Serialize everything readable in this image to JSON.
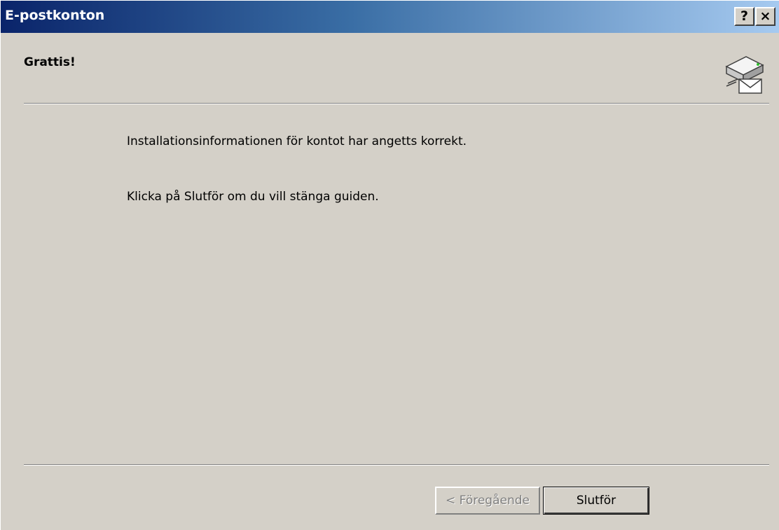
{
  "window": {
    "title": "E-postkonton",
    "help_label": "?",
    "close_label": "×"
  },
  "header": {
    "title": "Grattis!",
    "icon": "mail-server-icon"
  },
  "content": {
    "line1": "Installationsinformationen för kontot har angetts korrekt.",
    "line2": "Klicka på Slutför om du vill stänga guiden."
  },
  "buttons": {
    "back_label": "< Föregående",
    "finish_label": "Slutför"
  },
  "colors": {
    "titlebar_start": "#0a246a",
    "titlebar_end": "#a6caf0",
    "dialog_bg": "#d4d0c8",
    "disabled_text": "#808080"
  }
}
